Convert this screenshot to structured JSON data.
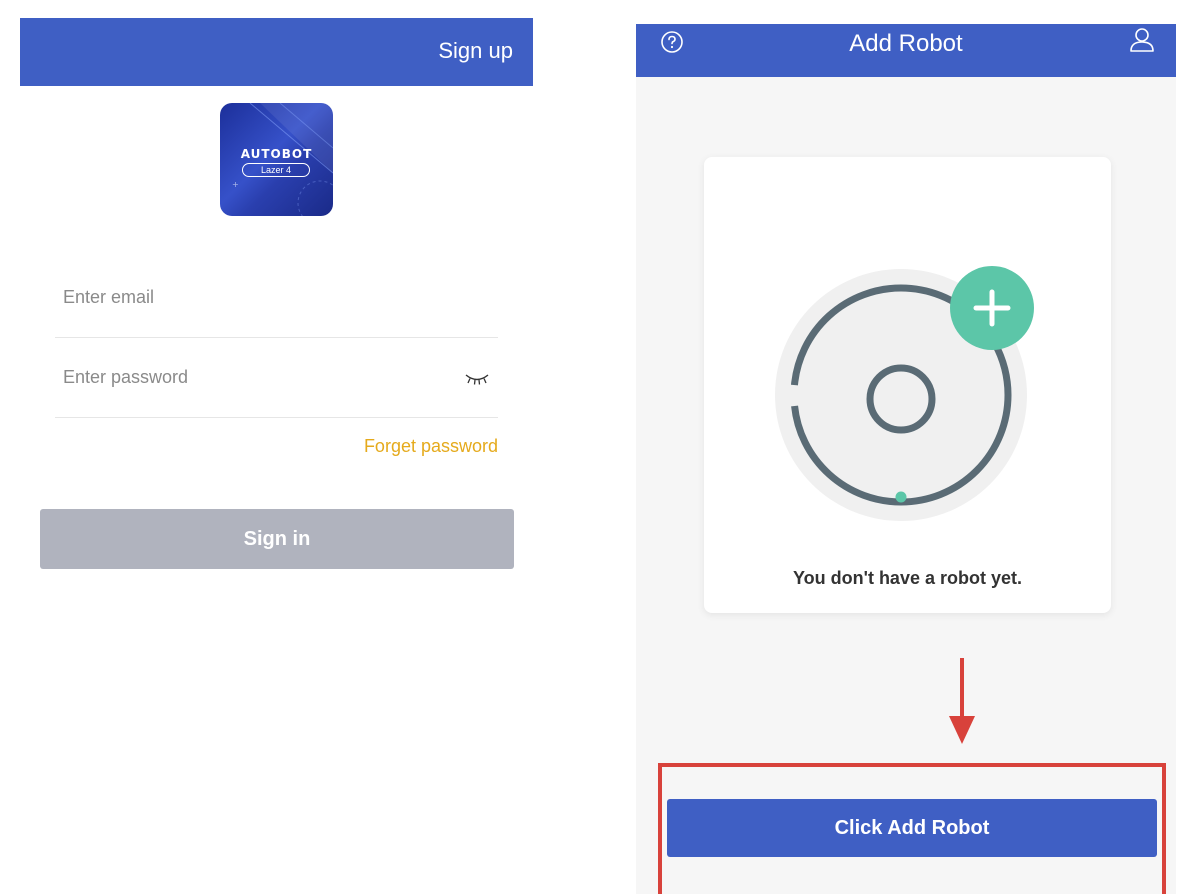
{
  "login_screen": {
    "signup_label": "Sign up",
    "logo": {
      "brand": "AUTOBOT",
      "model": "Lazer 4"
    },
    "email_placeholder": "Enter email",
    "password_placeholder": "Enter password",
    "forget_password_label": "Forget password",
    "signin_label": "Sign in"
  },
  "robot_screen": {
    "title": "Add Robot",
    "empty_message": "You don't have a robot yet.",
    "add_button_label": "Click Add Robot"
  },
  "colors": {
    "header_blue": "#3f5fc4",
    "link_gold": "#e5aa1c",
    "disabled_gray": "#b0b3be",
    "plus_teal": "#5cc6a8",
    "robot_slate": "#5a6b75",
    "annotation_red": "#d8423b"
  },
  "icons": {
    "help": "help-circle-icon",
    "user": "user-icon",
    "password_toggle": "eye-closed-icon",
    "add": "plus-icon",
    "annotation": "arrow-down-icon"
  }
}
